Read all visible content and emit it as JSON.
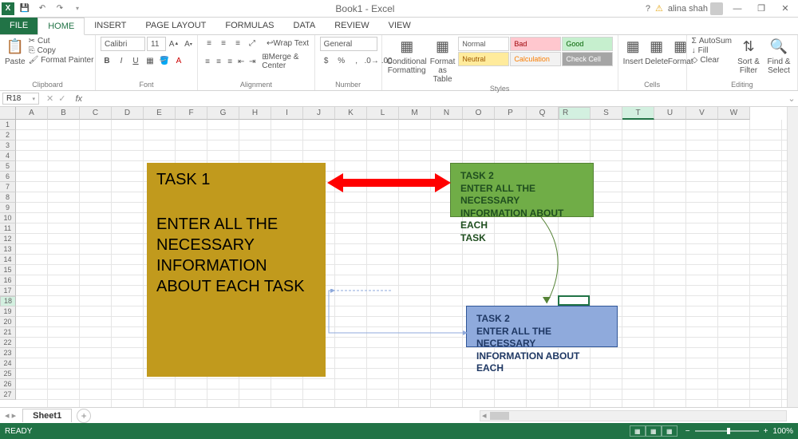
{
  "titlebar": {
    "title": "Book1 - Excel",
    "user": "alina shah",
    "help": "?"
  },
  "tabs": {
    "file": "FILE",
    "home": "HOME",
    "insert": "INSERT",
    "pagelayout": "PAGE LAYOUT",
    "formulas": "FORMULAS",
    "data": "DATA",
    "review": "REVIEW",
    "view": "VIEW"
  },
  "ribbon": {
    "clipboard": {
      "label": "Clipboard",
      "paste": "Paste",
      "cut": "Cut",
      "copy": "Copy",
      "fmtpainter": "Format Painter"
    },
    "font": {
      "label": "Font",
      "name": "Calibri",
      "size": "11"
    },
    "alignment": {
      "label": "Alignment",
      "wrap": "Wrap Text",
      "merge": "Merge & Center"
    },
    "number": {
      "label": "Number",
      "general": "General"
    },
    "styles": {
      "label": "Styles",
      "cond": "Conditional\nFormatting",
      "fmtas": "Format as\nTable",
      "normal": "Normal",
      "bad": "Bad",
      "good": "Good",
      "neutral": "Neutral",
      "calc": "Calculation",
      "check": "Check Cell"
    },
    "cells": {
      "label": "Cells",
      "insert": "Insert",
      "delete": "Delete",
      "format": "Format"
    },
    "editing": {
      "label": "Editing",
      "autosum": "AutoSum",
      "fill": "Fill",
      "clear": "Clear",
      "sort": "Sort &\nFilter",
      "find": "Find &\nSelect"
    }
  },
  "fbar": {
    "name": "R18",
    "fx": "fx"
  },
  "cols": [
    "A",
    "B",
    "C",
    "D",
    "E",
    "F",
    "G",
    "H",
    "I",
    "J",
    "K",
    "L",
    "M",
    "N",
    "O",
    "P",
    "Q",
    "R",
    "S",
    "T",
    "U",
    "V",
    "W"
  ],
  "rows": [
    "1",
    "2",
    "3",
    "4",
    "5",
    "6",
    "7",
    "8",
    "9",
    "10",
    "11",
    "12",
    "13",
    "14",
    "15",
    "16",
    "17",
    "18",
    "19",
    "20",
    "21",
    "22",
    "23",
    "24",
    "25",
    "26",
    "27"
  ],
  "shapes": {
    "s1": {
      "title": "TASK 1",
      "body": "ENTER ALL THE NECESSARY INFORMATION ABOUT  EACH TASK"
    },
    "s2": {
      "title": "TASK 2",
      "body": "ENTER ALL THE NECESSARY\nINFORMATION ABOUT  EACH\nTASK"
    },
    "s3": {
      "title": "TASK 2",
      "body": "ENTER ALL THE NECESSARY\nINFORMATION ABOUT  EACH"
    }
  },
  "sheet": {
    "name": "Sheet1"
  },
  "status": {
    "ready": "READY",
    "zoom": "100%"
  }
}
